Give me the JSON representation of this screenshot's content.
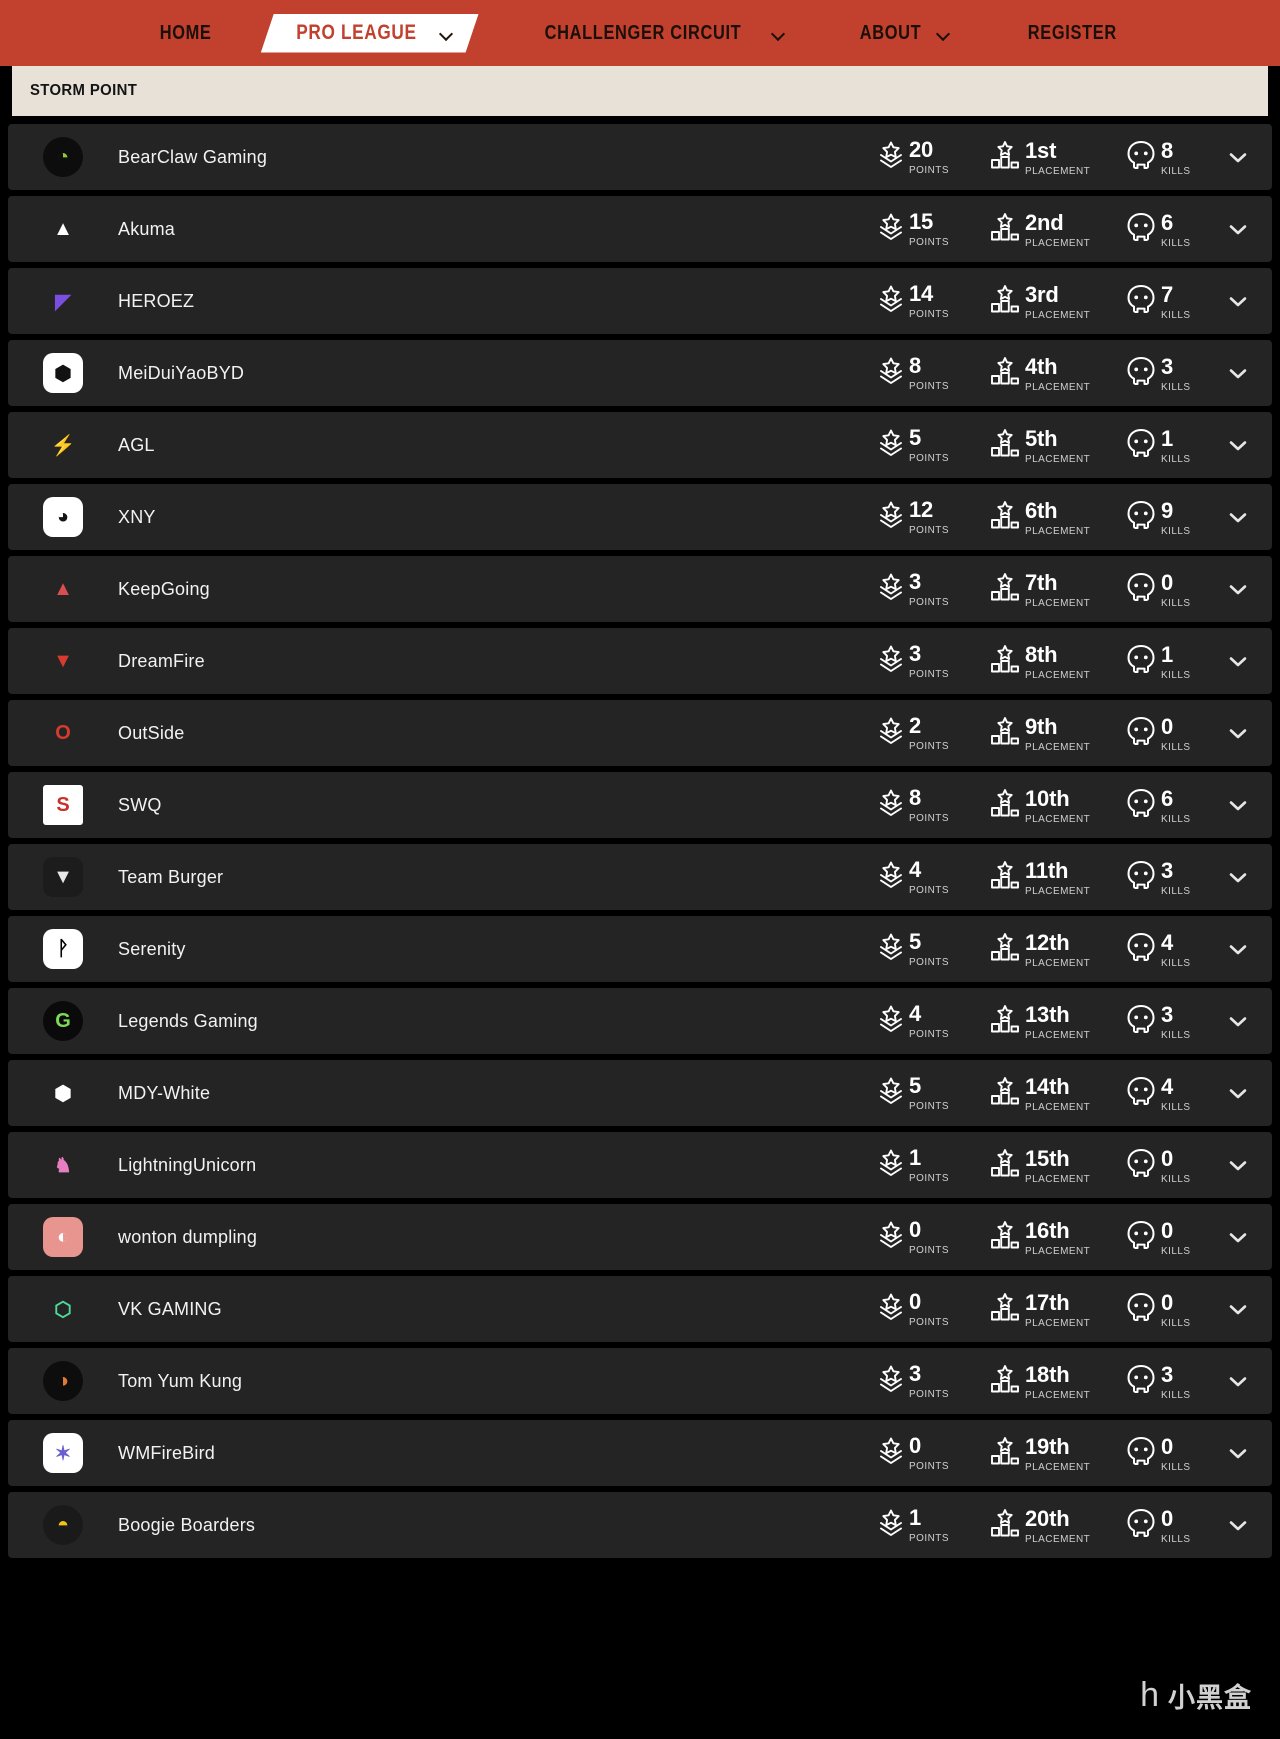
{
  "nav": {
    "items": [
      {
        "label": "HOME",
        "caret": false,
        "active": false
      },
      {
        "label": "PRO LEAGUE",
        "caret": true,
        "active": true
      },
      {
        "label": "CHALLENGER CIRCUIT",
        "caret": true,
        "active": false
      },
      {
        "label": "ABOUT",
        "caret": true,
        "active": false
      },
      {
        "label": "REGISTER",
        "caret": false,
        "active": false
      }
    ]
  },
  "map": {
    "title": "STORM POINT"
  },
  "columns": {
    "points_label": "POINTS",
    "placement_label": "PLACEMENT",
    "kills_label": "KILLS"
  },
  "icons": {
    "points": "rank-chevron-icon",
    "placement": "podium-icon",
    "kills": "skull-icon",
    "expand": "chevron-down-icon"
  },
  "watermark": {
    "mark": "h",
    "text": "小黑盒"
  },
  "rows": [
    {
      "team": "BearClaw Gaming",
      "points": "20",
      "placement": "1st",
      "kills": "8",
      "logo": {
        "shape": "round",
        "bg": "#0d0d0d",
        "fg": "#8ec63f",
        "glyph": "◔"
      }
    },
    {
      "team": "Akuma",
      "points": "15",
      "placement": "2nd",
      "kills": "6",
      "logo": {
        "shape": "sq",
        "bg": "#242424",
        "fg": "#ffffff",
        "glyph": "▲"
      }
    },
    {
      "team": "HEROEZ",
      "points": "14",
      "placement": "3rd",
      "kills": "7",
      "logo": {
        "shape": "sq",
        "bg": "#242424",
        "fg": "#7a4fe0",
        "glyph": "◤"
      }
    },
    {
      "team": "MeiDuiYaoBYD",
      "points": "8",
      "placement": "4th",
      "kills": "3",
      "logo": {
        "shape": "rounded",
        "bg": "#ffffff",
        "fg": "#121212",
        "glyph": "⬢"
      }
    },
    {
      "team": "AGL",
      "points": "5",
      "placement": "5th",
      "kills": "1",
      "logo": {
        "shape": "sq",
        "bg": "#242424",
        "fg": "#c33a3a",
        "glyph": "⚡"
      }
    },
    {
      "team": "XNY",
      "points": "12",
      "placement": "6th",
      "kills": "9",
      "logo": {
        "shape": "rounded",
        "bg": "#ffffff",
        "fg": "#141414",
        "glyph": "◕"
      }
    },
    {
      "team": "KeepGoing",
      "points": "3",
      "placement": "7th",
      "kills": "0",
      "logo": {
        "shape": "sq",
        "bg": "#242424",
        "fg": "#d94f4f",
        "glyph": "▲"
      }
    },
    {
      "team": "DreamFire",
      "points": "3",
      "placement": "8th",
      "kills": "1",
      "logo": {
        "shape": "sq",
        "bg": "#242424",
        "fg": "#d63b2e",
        "glyph": "▼"
      }
    },
    {
      "team": "OutSide",
      "points": "2",
      "placement": "9th",
      "kills": "0",
      "logo": {
        "shape": "sq",
        "bg": "#242424",
        "fg": "#d63b2e",
        "glyph": "O"
      }
    },
    {
      "team": "SWQ",
      "points": "8",
      "placement": "10th",
      "kills": "6",
      "logo": {
        "shape": "sq",
        "bg": "#ffffff",
        "fg": "#c8302a",
        "glyph": "S"
      }
    },
    {
      "team": "Team Burger",
      "points": "4",
      "placement": "11th",
      "kills": "3",
      "logo": {
        "shape": "rounded",
        "bg": "#1c1c1c",
        "fg": "#e8e8e8",
        "glyph": "▼"
      }
    },
    {
      "team": "Serenity",
      "points": "5",
      "placement": "12th",
      "kills": "4",
      "logo": {
        "shape": "rounded",
        "bg": "#ffffff",
        "fg": "#000000",
        "glyph": "ᚹ"
      }
    },
    {
      "team": "Legends Gaming",
      "points": "4",
      "placement": "13th",
      "kills": "3",
      "logo": {
        "shape": "round",
        "bg": "#0a0a0a",
        "fg": "#7ed957",
        "glyph": "G"
      }
    },
    {
      "team": "MDY-White",
      "points": "5",
      "placement": "14th",
      "kills": "4",
      "logo": {
        "shape": "sq",
        "bg": "#242424",
        "fg": "#ffffff",
        "glyph": "⬢"
      }
    },
    {
      "team": "LightningUnicorn",
      "points": "1",
      "placement": "15th",
      "kills": "0",
      "logo": {
        "shape": "sq",
        "bg": "#242424",
        "fg": "#e87fc0",
        "glyph": "♞"
      }
    },
    {
      "team": "wonton dumpling",
      "points": "0",
      "placement": "16th",
      "kills": "0",
      "logo": {
        "shape": "rounded",
        "bg": "#e8948f",
        "fg": "#ffffff",
        "glyph": "◐"
      }
    },
    {
      "team": "VK GAMING",
      "points": "0",
      "placement": "17th",
      "kills": "0",
      "logo": {
        "shape": "sq",
        "bg": "#242424",
        "fg": "#4ed99a",
        "glyph": "⬡"
      }
    },
    {
      "team": "Tom Yum Kung",
      "points": "3",
      "placement": "18th",
      "kills": "3",
      "logo": {
        "shape": "round",
        "bg": "#0d0d0d",
        "fg": "#e07a35",
        "glyph": "◑"
      }
    },
    {
      "team": "WMFireBird",
      "points": "0",
      "placement": "19th",
      "kills": "0",
      "logo": {
        "shape": "rounded",
        "bg": "#ffffff",
        "fg": "#6b5fd0",
        "glyph": "✶"
      }
    },
    {
      "team": "Boogie Boarders",
      "points": "1",
      "placement": "20th",
      "kills": "0",
      "logo": {
        "shape": "round",
        "bg": "#1a1a1a",
        "fg": "#f0c419",
        "glyph": "◓"
      }
    }
  ]
}
